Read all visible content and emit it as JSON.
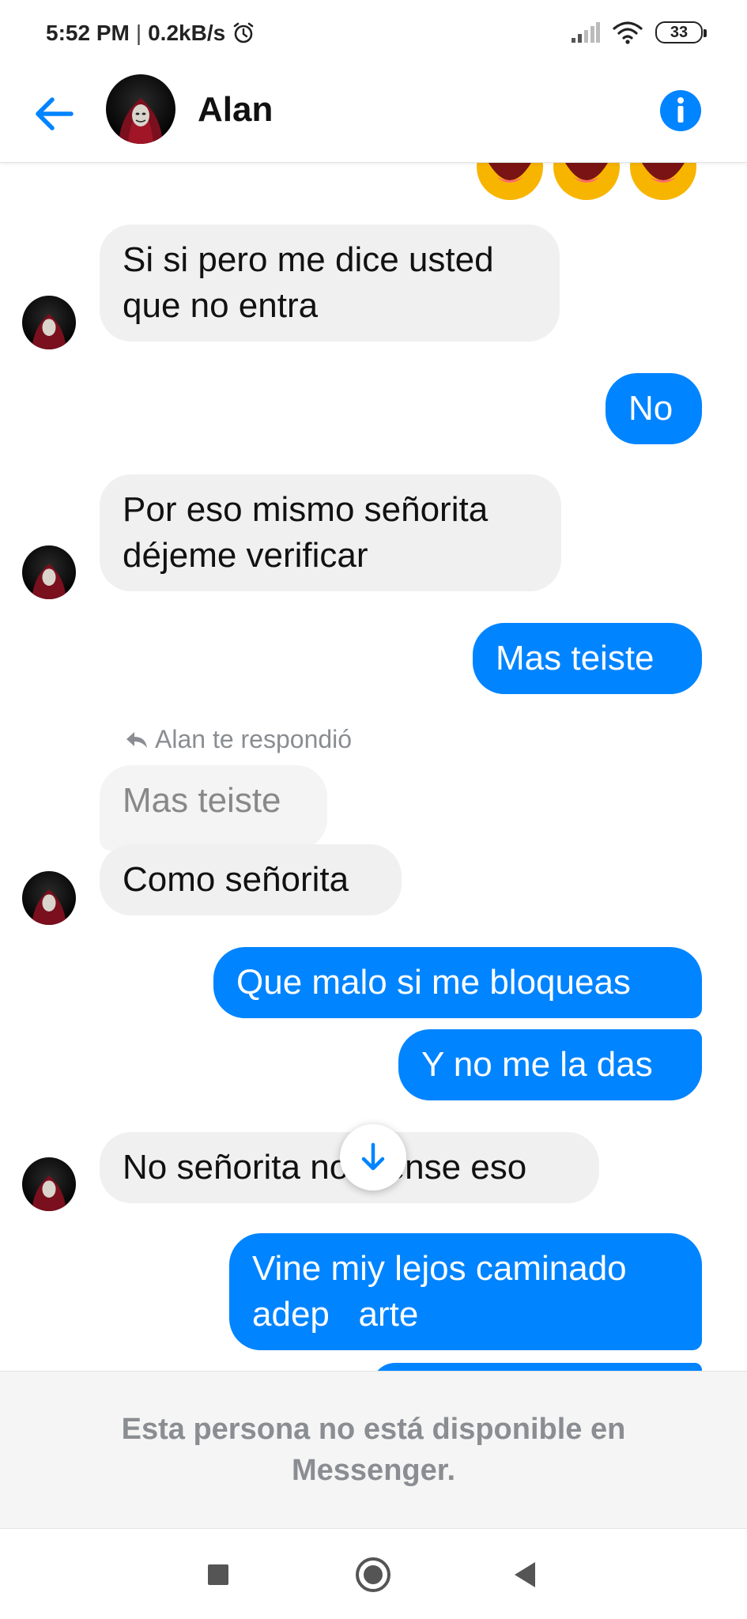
{
  "status_bar": {
    "time": "5:52 PM",
    "separator": "|",
    "network_speed": "0.2kB/s",
    "battery": "33",
    "icons": [
      "alarm-icon",
      "signal-icon",
      "wifi-icon",
      "battery-icon"
    ]
  },
  "header": {
    "contact_name": "Alan",
    "back_icon": "back-arrow-icon",
    "info_icon": "info-icon",
    "accent_color": "#0084ff"
  },
  "messages": [
    {
      "from": "them",
      "text": "Si si pero me dice usted que no entra"
    },
    {
      "from": "me",
      "text": "No"
    },
    {
      "from": "them",
      "text": "Por eso mismo señorita déjeme verificar"
    },
    {
      "from": "me",
      "text": "Mas teiste"
    },
    {
      "from": "them",
      "reply_note": "Alan te respondió",
      "quoted_text": "Mas teiste",
      "text": "Como señorita"
    },
    {
      "from": "me",
      "text": "Que malo si me bloqueas"
    },
    {
      "from": "me",
      "text": "Y no me la das"
    },
    {
      "from": "them",
      "text": "No señorita no piense eso"
    },
    {
      "from": "me",
      "text": "Vine miy lejos caminado adep   arte"
    }
  ],
  "notice": {
    "text": "Esta persona no está disponible en Messenger."
  },
  "nav": {
    "icons": [
      "recents-square-icon",
      "home-circle-icon",
      "back-triangle-icon"
    ]
  },
  "colors": {
    "outgoing_bubble": "#0084ff",
    "incoming_bubble": "#f0f0f0"
  }
}
